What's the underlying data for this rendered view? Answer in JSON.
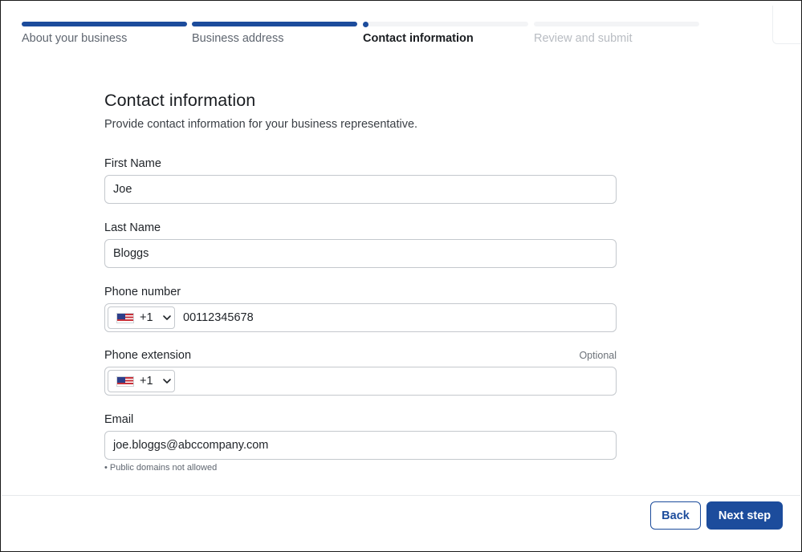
{
  "stepper": {
    "steps": [
      {
        "label": "About your business",
        "state": "complete"
      },
      {
        "label": "Business address",
        "state": "complete"
      },
      {
        "label": "Contact information",
        "state": "current"
      },
      {
        "label": "Review and submit",
        "state": "upcoming"
      }
    ]
  },
  "form": {
    "title": "Contact information",
    "subtitle": "Provide contact information for your business representative.",
    "first_name": {
      "label": "First Name",
      "value": "Joe"
    },
    "last_name": {
      "label": "Last Name",
      "value": "Bloggs"
    },
    "phone": {
      "label": "Phone number",
      "country_icon": "us-flag-icon",
      "dial_code": "+1",
      "value": "00112345678"
    },
    "phone_ext": {
      "label": "Phone extension",
      "optional_label": "Optional",
      "country_icon": "us-flag-icon",
      "dial_code": "+1",
      "value": ""
    },
    "email": {
      "label": "Email",
      "value": "joe.bloggs@abccompany.com",
      "hint": "• Public domains not allowed"
    }
  },
  "actions": {
    "back_label": "Back",
    "next_label": "Next step"
  },
  "colors": {
    "accent": "#1c4c9c",
    "track": "#f3f4f6",
    "border": "#c4c8cd"
  }
}
